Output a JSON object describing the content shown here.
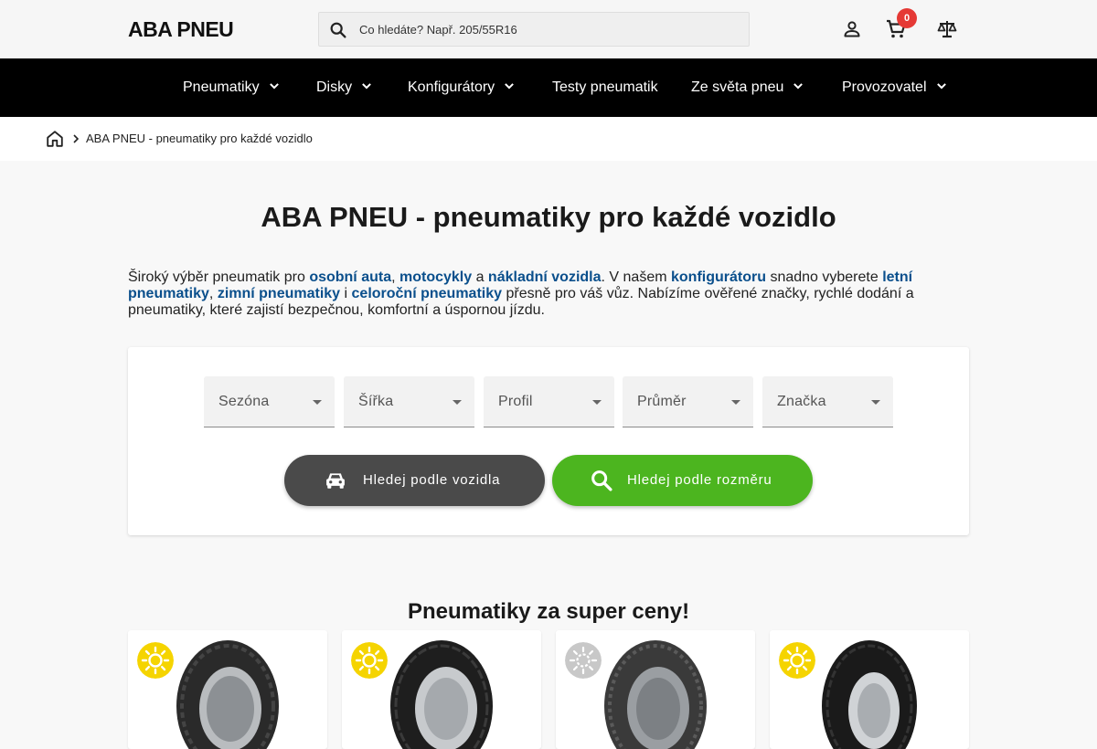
{
  "header": {
    "logo": "ABA PNEU",
    "search_placeholder": "Co hledáte? Např. 205/55R16",
    "cart_count": "0"
  },
  "nav": {
    "items": [
      {
        "label": "Pneumatiky",
        "has_dropdown": true
      },
      {
        "label": "Disky",
        "has_dropdown": true
      },
      {
        "label": "Konfigurátory",
        "has_dropdown": true
      },
      {
        "label": "Testy pneumatik",
        "has_dropdown": false
      },
      {
        "label": "Ze světa pneu",
        "has_dropdown": true
      },
      {
        "label": "Provozovatel",
        "has_dropdown": true
      }
    ]
  },
  "breadcrumb": {
    "current": "ABA PNEU - pneumatiky pro každé vozidlo"
  },
  "main": {
    "title": "ABA PNEU - pneumatiky pro každé vozidlo",
    "intro": {
      "t1": "Široký výběr pneumatik pro ",
      "l1": "osobní auta",
      "t2": ", ",
      "l2": "motocykly",
      "t3": " a ",
      "l3": "nákladní vozidla",
      "t4": ". V našem ",
      "l4": "konfigurátoru",
      "t5": " snadno vyberete ",
      "l5": "letní pneumatiky",
      "t6": ", ",
      "l6": "zimní pneumatiky",
      "t7": " i ",
      "l7": "celoroční pneumatiky",
      "t8": " přesně pro váš vůz. Nabízíme ověřené značky, rychlé dodání a pneumatiky, které zajistí bezpečnou, komfortní a úspornou jízdu."
    },
    "filters": {
      "season": "Sezóna",
      "width": "Šířka",
      "profile": "Profil",
      "diameter": "Průměr",
      "brand": "Značka"
    },
    "buttons": {
      "by_vehicle": "Hledej podle vozidla",
      "by_size": "Hledej podle rozměru"
    },
    "deals_title": "Pneumatiky za super ceny!",
    "products": [
      {
        "season": "summer",
        "badge_color": "#f5d400",
        "icon": "sun-icon"
      },
      {
        "season": "summer",
        "badge_color": "#f5d400",
        "icon": "sun-icon"
      },
      {
        "season": "winter",
        "badge_color": "#c8c8c8",
        "icon": "snow-sun-icon"
      },
      {
        "season": "summer",
        "badge_color": "#f5d400",
        "icon": "sun-icon"
      }
    ]
  },
  "colors": {
    "accent_green": "#4cb51f",
    "dark_button": "#4a4a4a",
    "link_blue": "#0a4f8c",
    "badge_red": "#e53935"
  }
}
